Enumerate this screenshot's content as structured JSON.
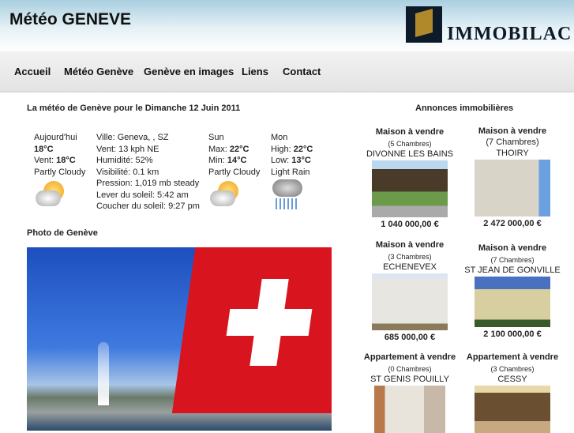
{
  "header": {
    "title": "Météo GENEVE",
    "logo_text": "IMMOBILAC"
  },
  "nav": [
    "Accueil",
    "Météo Genève",
    "Genève en images",
    "Liens",
    "Contact"
  ],
  "weather": {
    "heading": "La météo de Genève pour le Dimanche 12 Juin 2011",
    "today": {
      "label": "Aujourd'hui",
      "temp": "18°C",
      "wind_label": "Vent: ",
      "wind": "18°C",
      "cond": "Partly Cloudy",
      "icon": "partly-cloudy-icon"
    },
    "details": [
      "Ville: Geneva, , SZ",
      "Vent: 13 kph NE",
      "Humidité: 52%",
      "Visibilité: 0.1 km",
      "Pression: 1,019 mb steady",
      "Lever du soleil: 5:42 am",
      "Coucher du soleil: 9:27 pm"
    ],
    "sun": {
      "day": "Sun",
      "max_label": "Max: ",
      "max": "22°C",
      "min_label": "Min: ",
      "min": "14°C",
      "cond": "Partly Cloudy",
      "icon": "partly-cloudy-icon"
    },
    "mon": {
      "day": "Mon",
      "max_label": "High: ",
      "max": "22°C",
      "min_label": "Low: ",
      "min": "13°C",
      "cond": "Light Rain",
      "icon": "light-rain-icon"
    }
  },
  "photo": {
    "heading": "Photo de Genève"
  },
  "ads": {
    "heading": "Annonces immobilières",
    "items": [
      {
        "type": "Maison à vendre",
        "rooms": "(5 Chambres)",
        "city": "DIVONNE LES BAINS",
        "price": "1 040 000,00 €"
      },
      {
        "type": "Maison à vendre",
        "rooms": "(7 Chambres)",
        "city": "THOIRY",
        "price": "2 472 000,00 €"
      },
      {
        "type": "Maison à vendre",
        "rooms": "(3 Chambres)",
        "city": "ECHENEVEX",
        "price": "685 000,00 €"
      },
      {
        "type": "Maison à vendre",
        "rooms": "(7 Chambres)",
        "city": "ST JEAN DE GONVILLE",
        "price": "2 100 000,00 €"
      },
      {
        "type": "Appartement à vendre",
        "rooms": "(0 Chambres)",
        "city": "ST GENIS POUILLY",
        "price": ""
      },
      {
        "type": "Appartement à vendre",
        "rooms": "(3 Chambres)",
        "city": "CESSY",
        "price": ""
      }
    ]
  }
}
